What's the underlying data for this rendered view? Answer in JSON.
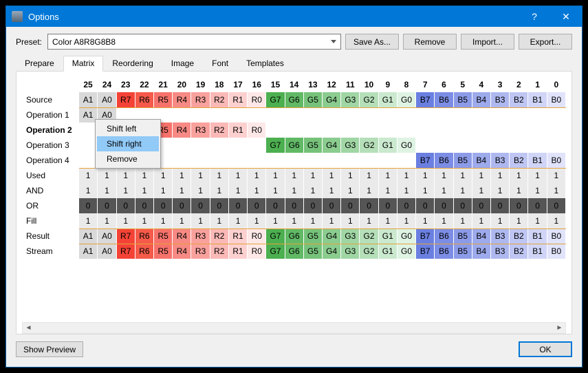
{
  "window": {
    "title": "Options"
  },
  "titlebar": {
    "help": "?",
    "close": "✕"
  },
  "preset": {
    "label": "Preset:",
    "value": "Color A8R8G8B8",
    "buttons": {
      "save_as": "Save As...",
      "remove": "Remove",
      "import": "Import...",
      "export": "Export..."
    }
  },
  "tabs": [
    "Prepare",
    "Matrix",
    "Reordering",
    "Image",
    "Font",
    "Templates"
  ],
  "active_tab": "Matrix",
  "columns": [
    "25",
    "24",
    "23",
    "22",
    "21",
    "20",
    "19",
    "18",
    "17",
    "16",
    "15",
    "14",
    "13",
    "12",
    "11",
    "10",
    "9",
    "8",
    "7",
    "6",
    "5",
    "4",
    "3",
    "2",
    "1",
    "0"
  ],
  "rows": [
    {
      "label": "Source",
      "kind": "src",
      "cells": [
        "A1",
        "A0",
        "R7",
        "R6",
        "R5",
        "R4",
        "R3",
        "R2",
        "R1",
        "R0",
        "G7",
        "G6",
        "G5",
        "G4",
        "G3",
        "G2",
        "G1",
        "G0",
        "B7",
        "B6",
        "B5",
        "B4",
        "B3",
        "B2",
        "B1",
        "B0"
      ],
      "sep": true
    },
    {
      "label": "Operation 1",
      "kind": "op",
      "cells": [
        "A1",
        "A0",
        "",
        "",
        "",
        "",
        "",
        "",
        "",
        "",
        "",
        "",
        "",
        "",
        "",
        "",
        "",
        "",
        "",
        "",
        "",
        "",
        "",
        "",
        "",
        ""
      ]
    },
    {
      "label": "Operation 2",
      "kind": "op",
      "selected": true,
      "cells": [
        "",
        "",
        "",
        "",
        "R5",
        "R4",
        "R3",
        "R2",
        "R1",
        "R0",
        "",
        "",
        "",
        "",
        "",
        "",
        "",
        "",
        "",
        "",
        "",
        "",
        "",
        "",
        "",
        ""
      ]
    },
    {
      "label": "Operation 3",
      "kind": "op",
      "cells": [
        "",
        "",
        "",
        "",
        "",
        "",
        "",
        "",
        "",
        "",
        "G7",
        "G6",
        "G5",
        "G4",
        "G3",
        "G2",
        "G1",
        "G0",
        "",
        "",
        "",
        "",
        "",
        "",
        "",
        ""
      ]
    },
    {
      "label": "Operation 4",
      "kind": "op",
      "cells": [
        "",
        "",
        "",
        "",
        "",
        "",
        "",
        "",
        "",
        "",
        "",
        "",
        "",
        "",
        "",
        "",
        "",
        "",
        "B7",
        "B6",
        "B5",
        "B4",
        "B3",
        "B2",
        "B1",
        "B0"
      ],
      "sep": true
    },
    {
      "label": "Used",
      "kind": "mono",
      "cells": [
        "1",
        "1",
        "1",
        "1",
        "1",
        "1",
        "1",
        "1",
        "1",
        "1",
        "1",
        "1",
        "1",
        "1",
        "1",
        "1",
        "1",
        "1",
        "1",
        "1",
        "1",
        "1",
        "1",
        "1",
        "1",
        "1"
      ]
    },
    {
      "label": "AND",
      "kind": "mono",
      "cells": [
        "1",
        "1",
        "1",
        "1",
        "1",
        "1",
        "1",
        "1",
        "1",
        "1",
        "1",
        "1",
        "1",
        "1",
        "1",
        "1",
        "1",
        "1",
        "1",
        "1",
        "1",
        "1",
        "1",
        "1",
        "1",
        "1"
      ]
    },
    {
      "label": "OR",
      "kind": "dark",
      "cells": [
        "0",
        "0",
        "0",
        "0",
        "0",
        "0",
        "0",
        "0",
        "0",
        "0",
        "0",
        "0",
        "0",
        "0",
        "0",
        "0",
        "0",
        "0",
        "0",
        "0",
        "0",
        "0",
        "0",
        "0",
        "0",
        "0"
      ]
    },
    {
      "label": "Fill",
      "kind": "mono",
      "cells": [
        "1",
        "1",
        "1",
        "1",
        "1",
        "1",
        "1",
        "1",
        "1",
        "1",
        "1",
        "1",
        "1",
        "1",
        "1",
        "1",
        "1",
        "1",
        "1",
        "1",
        "1",
        "1",
        "1",
        "1",
        "1",
        "1"
      ],
      "sep": true
    },
    {
      "label": "Result",
      "kind": "src",
      "cells": [
        "A1",
        "A0",
        "R7",
        "R6",
        "R5",
        "R4",
        "R3",
        "R2",
        "R1",
        "R0",
        "G7",
        "G6",
        "G5",
        "G4",
        "G3",
        "G2",
        "G1",
        "G0",
        "B7",
        "B6",
        "B5",
        "B4",
        "B3",
        "B2",
        "B1",
        "B0"
      ],
      "sep": true
    },
    {
      "label": "Stream",
      "kind": "src",
      "cells": [
        "A1",
        "A0",
        "R7",
        "R6",
        "R5",
        "R4",
        "R3",
        "R2",
        "R1",
        "R0",
        "G7",
        "G6",
        "G5",
        "G4",
        "G3",
        "G2",
        "G1",
        "G0",
        "B7",
        "B6",
        "B5",
        "B4",
        "B3",
        "B2",
        "B1",
        "B0"
      ]
    }
  ],
  "context_menu": {
    "items": [
      "Shift left",
      "Shift right",
      "Remove"
    ],
    "highlighted": "Shift right"
  },
  "footer": {
    "show_preview": "Show Preview",
    "ok": "OK"
  }
}
